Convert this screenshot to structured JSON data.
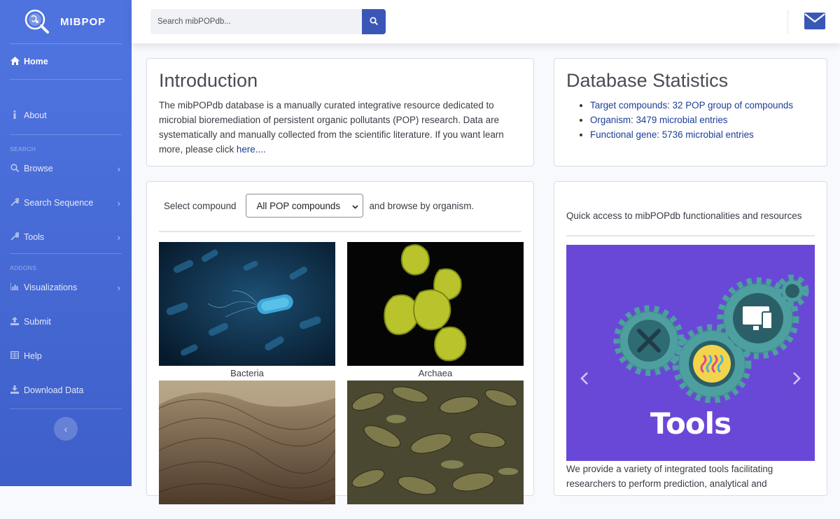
{
  "brand": {
    "name": "MIBPOP"
  },
  "sidebar": {
    "home": "Home",
    "about": "About",
    "heading_search": "SEARCH",
    "browse": "Browse",
    "search_sequence": "Search Sequence",
    "tools": "Tools",
    "heading_addons": "ADDONS",
    "visualizations": "Visualizations",
    "submit": "Submit",
    "help": "Help",
    "download": "Download Data",
    "collapse_glyph": "‹"
  },
  "search": {
    "placeholder": "Search mibPOPdb..."
  },
  "intro": {
    "title": "Introduction",
    "text": "The mibPOPdb database is a manually curated integrative resource dedicated to microbial bioremediation of persistent organic pollutants (POP) research. Data are systematically and manually collected from the scientific literature. If you want learn more, please click ",
    "link": "here...."
  },
  "stats": {
    "title": "Database Statistics",
    "items": [
      "Target compounds: 32 POP group of compounds",
      "Organism: 3479 microbial entries",
      "Functional gene: 5736 microbial entries"
    ]
  },
  "browse": {
    "label_before": "Select compound",
    "select_value": "All POP compounds",
    "label_after": "and browse by organism.",
    "tiles": [
      "Bacteria",
      "Archaea",
      "",
      ""
    ]
  },
  "quick": {
    "title": "Quick access to mibPOPdb functionalities and resources",
    "slide_label": "Tools",
    "desc": "We provide a variety of integrated tools facilitating researchers to perform prediction, analytical and"
  },
  "colors": {
    "sidebar": "#4e73df",
    "accent": "#3a57b7",
    "link": "#1a3d96",
    "slide_bg": "#6a48d7"
  },
  "icons": [
    "search-icon",
    "envelope-icon",
    "home-icon",
    "info-icon",
    "wrench-icon",
    "chart-icon",
    "upload-icon",
    "table-icon",
    "download-icon",
    "chevron-right-icon"
  ]
}
